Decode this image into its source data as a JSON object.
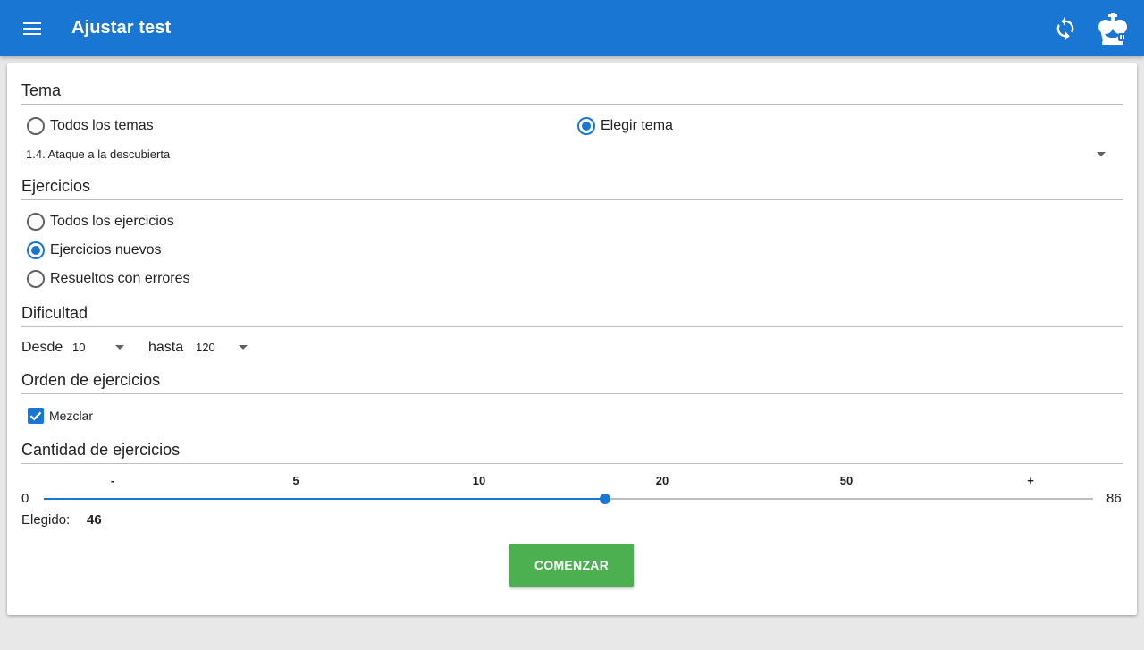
{
  "appbar": {
    "title": "Ajustar test",
    "color": "#1976d2"
  },
  "tema": {
    "heading": "Tema",
    "options": [
      {
        "label": "Todos los temas",
        "checked": false
      },
      {
        "label": "Elegir tema",
        "checked": true
      }
    ],
    "selected_topic": "1.4. Ataque a la descubierta"
  },
  "ejercicios": {
    "heading": "Ejercicios",
    "options": [
      {
        "label": "Todos los ejercicios",
        "checked": false
      },
      {
        "label": "Ejercicios nuevos",
        "checked": true
      },
      {
        "label": "Resueltos con errores",
        "checked": false
      }
    ]
  },
  "dificultad": {
    "heading": "Dificultad",
    "from_label": "Desde",
    "from_value": "10",
    "to_label": "hasta",
    "to_value": "120"
  },
  "orden": {
    "heading": "Orden de ejercicios",
    "shuffle_label": "Mezclar",
    "shuffle_checked": true
  },
  "cantidad": {
    "heading": "Cantidad de ejercicios",
    "presets": [
      "-",
      "5",
      "10",
      "20",
      "50",
      "+"
    ],
    "min_label": "0",
    "max_label": "86",
    "min": 0,
    "max": 86,
    "value": 46,
    "chosen_label": "Elegido:",
    "chosen_value": "46"
  },
  "start_button": {
    "label": "COMENZAR",
    "color": "#4caf50"
  },
  "icons": {
    "menu": "hamburger-menu-icon",
    "sync": "sync-icon",
    "logo": "chess-king-logo-icon",
    "dropdown": "dropdown-arrow-icon",
    "check": "checkmark-icon"
  }
}
